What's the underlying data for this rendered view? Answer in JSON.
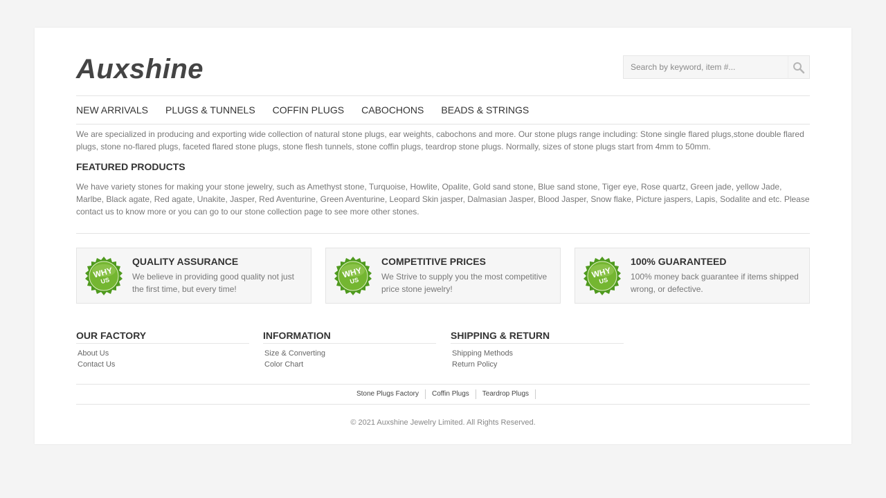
{
  "header": {
    "logo": "Auxshine",
    "search": {
      "placeholder": "Search by keyword, item #..."
    }
  },
  "nav": {
    "items": [
      "NEW ARRIVALS",
      "PLUGS & TUNNELS",
      "COFFIN PLUGS",
      "CABOCHONS",
      "BEADS & STRINGS"
    ]
  },
  "intro": "We are specialized in producing and exporting wide collection of natural stone plugs, ear weights, cabochons and more. Our stone plugs range including: Stone single flared plugs,stone double flared plugs, stone no-flared plugs, faceted flared stone plugs, stone flesh tunnels, stone coffin plugs, teardrop stone plugs. Normally, sizes of stone plugs start from 4mm to 50mm.",
  "featured": {
    "title": "FEATURED PRODUCTS",
    "text": "We have variety stones for making your stone jewelry, such as Amethyst stone, Turquoise, Howlite, Opalite, Gold sand stone, Blue sand stone, Tiger eye, Rose quartz, Green jade, yellow Jade, Marlbe, Black agate, Red agate, Unakite, Jasper, Red Aventurine, Green Aventurine, Leopard Skin jasper, Dalmasian Jasper, Blood Jasper, Snow flake, Picture jaspers, Lapis, Sodalite and etc. Please contact us to know more or you can go to our stone collection page to see more other stones."
  },
  "features": [
    {
      "badge_top": "WHY",
      "badge_bottom": "US",
      "title": "QUALITY ASSURANCE",
      "text": "We believe in providing good quality not just the first time, but every time!"
    },
    {
      "badge_top": "WHY",
      "badge_bottom": "US",
      "title": "COMPETITIVE PRICES",
      "text": "We Strive to supply you the most competitive price stone jewelry!"
    },
    {
      "badge_top": "WHY",
      "badge_bottom": "US",
      "title": "100% GUARANTEED",
      "text": "100% money back guarantee if items shipped wrong, or defective."
    }
  ],
  "footer": {
    "columns": [
      {
        "title": "OUR FACTORY",
        "links": [
          "About Us",
          "Contact Us"
        ]
      },
      {
        "title": "INFORMATION",
        "links": [
          "Size & Converting",
          "Color Chart"
        ]
      },
      {
        "title": "SHIPPING & RETURN",
        "links": [
          "Shipping Methods",
          "Return Policy"
        ]
      }
    ],
    "bottom_links": [
      "Stone Plugs Factory",
      "Coffin Plugs",
      "Teardrop Plugs"
    ],
    "copyright": "© 2021 Auxshine Jewelry Limited. All Rights Reserved."
  },
  "colors": {
    "badge_green": "#6fae2c",
    "badge_dark": "#3f7d16",
    "text": "#777777",
    "heading": "#333333"
  },
  "icons": {
    "search": "magnifier-icon",
    "badge": "why-us-badge-icon"
  }
}
